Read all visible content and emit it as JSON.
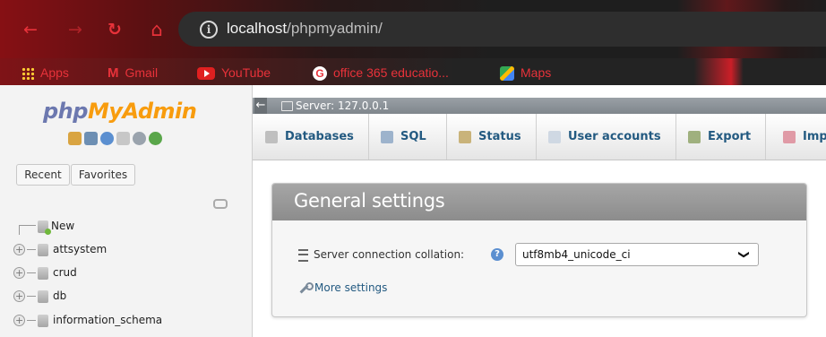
{
  "browser": {
    "url_host": "localhost",
    "url_path": "/phpmyadmin/",
    "bookmarks": {
      "apps": "Apps",
      "gmail": "Gmail",
      "youtube": "YouTube",
      "office": "office 365 educatio...",
      "maps": "Maps"
    }
  },
  "sidebar": {
    "logo_part1": "php",
    "logo_part2": "MyAdmin",
    "recent_label": "Recent",
    "favorites_label": "Favorites",
    "tree": [
      {
        "label": "New"
      },
      {
        "label": "attsystem"
      },
      {
        "label": "crud"
      },
      {
        "label": "db"
      },
      {
        "label": "information_schema"
      }
    ]
  },
  "main": {
    "server_label": "Server: 127.0.0.1",
    "tabs": [
      {
        "label": "Databases"
      },
      {
        "label": "SQL"
      },
      {
        "label": "Status"
      },
      {
        "label": "User accounts"
      },
      {
        "label": "Export"
      },
      {
        "label": "Imp"
      }
    ],
    "general_settings": {
      "title": "General settings",
      "collation_label": "Server connection collation:",
      "collation_value": "utf8mb4_unicode_ci",
      "more_settings": "More settings"
    }
  },
  "colors": {
    "accent_red": "#e8323a",
    "pma_blue": "#6c78af",
    "pma_orange": "#f89c0e",
    "link_blue": "#235a81"
  }
}
